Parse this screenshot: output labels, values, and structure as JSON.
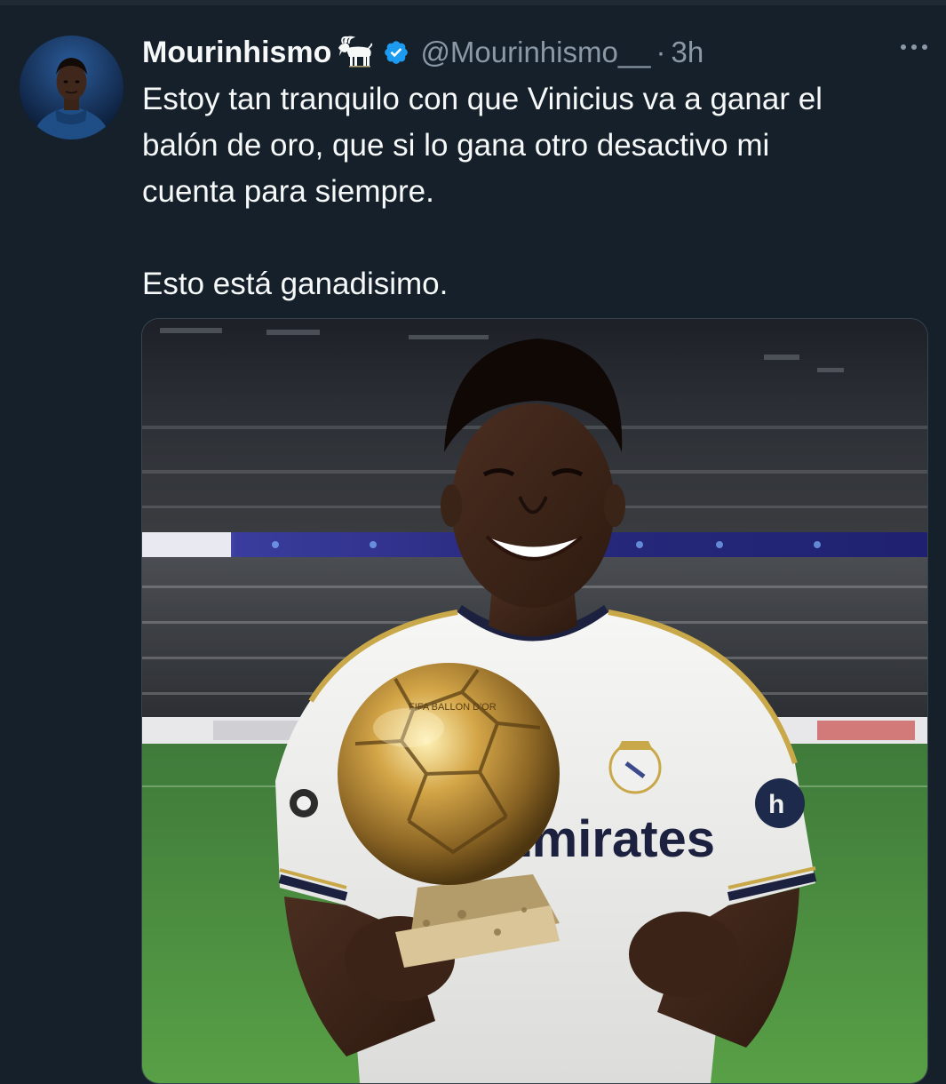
{
  "tweet": {
    "display_name": "Mourinhismo",
    "handle": "@Mourinhismo__",
    "separator": "·",
    "timestamp": "3h",
    "text_lines": [
      "Estoy tan tranquilo con que Vinicius va a ganar el",
      "balón de oro, que si lo gana otro desactivo mi",
      "cuenta para siempre."
    ],
    "text_line_2": "Esto está ganadisimo.",
    "icons": {
      "name_emoji": "goat-icon",
      "verified": "verified-badge-icon",
      "more": "more-options-icon"
    }
  },
  "media": {
    "shirt_sponsor": "Emirates",
    "trophy_engraving": "FIFA BALLON D'OR"
  },
  "colors": {
    "background": "#15202b",
    "text_primary": "#f7f9f9",
    "text_secondary": "#8b98a5",
    "verified_blue": "#1d9bf0",
    "border": "#38444d"
  }
}
